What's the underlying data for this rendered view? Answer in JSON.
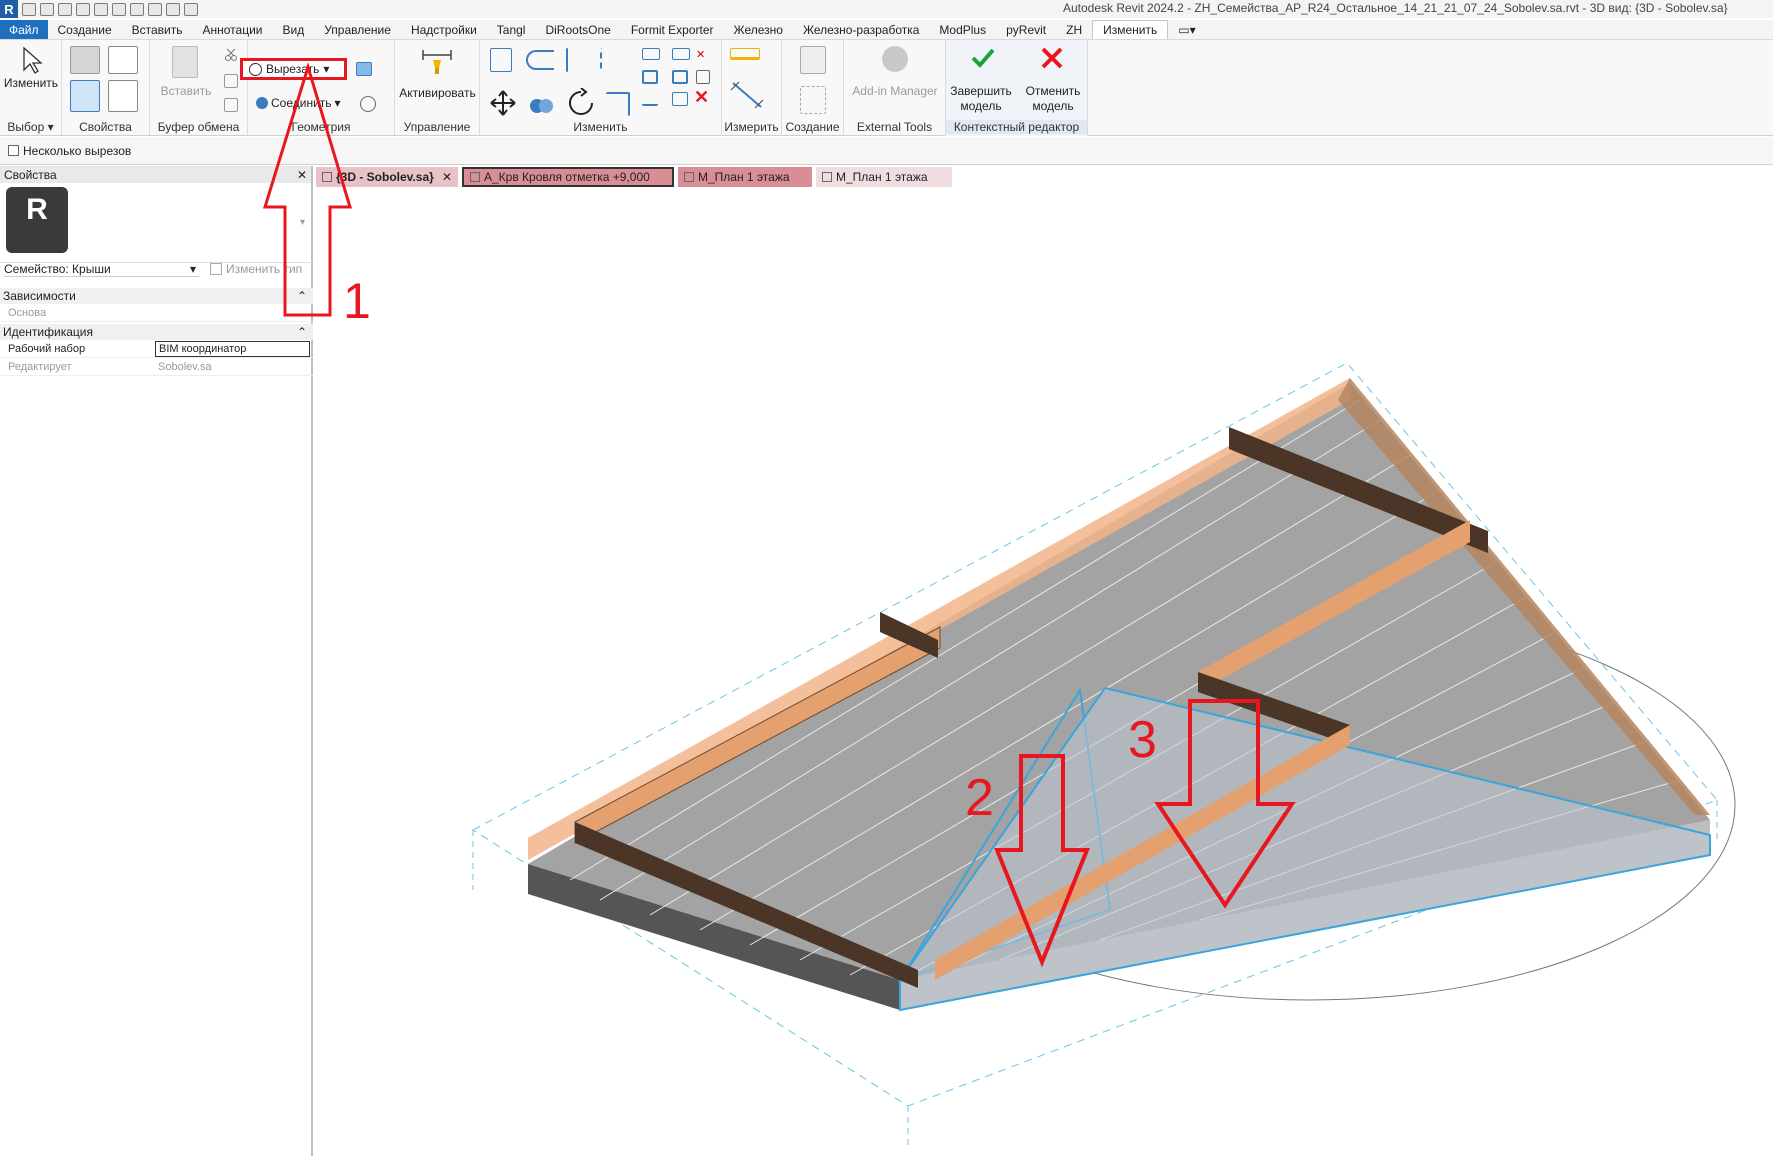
{
  "app": {
    "logo_letter": "R",
    "window_title": "Autodesk Revit 2024.2 - ZH_Семейства_АР_R24_Остальное_14_21_21_07_24_Sobolev.sa.rvt - 3D вид: {3D - Sobolev.sa}"
  },
  "ribbon_tabs": [
    "Файл",
    "Создание",
    "Вставить",
    "Аннотации",
    "Вид",
    "Управление",
    "Надстройки",
    "Tangl",
    "DiRootsOne",
    "Formit Exporter",
    "Железно",
    "Железно-разработка",
    "ModPlus",
    "pyRevit",
    "ZH",
    "Изменить"
  ],
  "ribbon": {
    "modify_label": "Изменить",
    "select_label": "Выбор ▾",
    "properties_panel": "Свойства",
    "paste_label": "Вставить",
    "clipboard_panel": "Буфер обмена",
    "cut_label": "Вырезать",
    "join_label": "Соединить",
    "geometry_panel": "Геометрия",
    "activate_label": "Активировать",
    "manage_panel": "Управление",
    "modify_panel": "Изменить",
    "measure_panel": "Измерить",
    "create_panel": "Создание",
    "addin_label": "Add-in Manager",
    "external_panel": "External Tools",
    "finish_label_1": "Завершить",
    "finish_label_2": "модель",
    "cancel_label_1": "Отменить",
    "cancel_label_2": "модель",
    "context_panel": "Контекстный редактор"
  },
  "options_bar": {
    "multiple_cuts_label": "Несколько вырезов"
  },
  "properties": {
    "title": "Свойства",
    "type_letter": "R",
    "family_label": "Семейство: Крыши",
    "edit_type_label": "Изменить тип",
    "sections": [
      {
        "name": "Зависимости",
        "rows": [
          {
            "key": "Основа",
            "value": ""
          }
        ]
      },
      {
        "name": "Идентификация",
        "rows": [
          {
            "key": "Рабочий набор",
            "value": "BIM координатор"
          },
          {
            "key": "Редактирует",
            "value": "Sobolev.sa"
          }
        ]
      }
    ]
  },
  "view_tabs": [
    "{3D - Sobolev.sa}",
    "А_Крв Кровля отметка +9,000",
    "М_План 1 этажа",
    "М_План 1 этажа"
  ],
  "annotations": {
    "label_1": "1",
    "label_2": "2",
    "label_3": "3"
  },
  "colors": {
    "file_tab": "#1f6fbf",
    "annotation_red": "#e8171f",
    "beam_orange": "#e5a06f",
    "roof_gray": "#a3a3a3",
    "selection_blue": "#3aa5dc"
  }
}
